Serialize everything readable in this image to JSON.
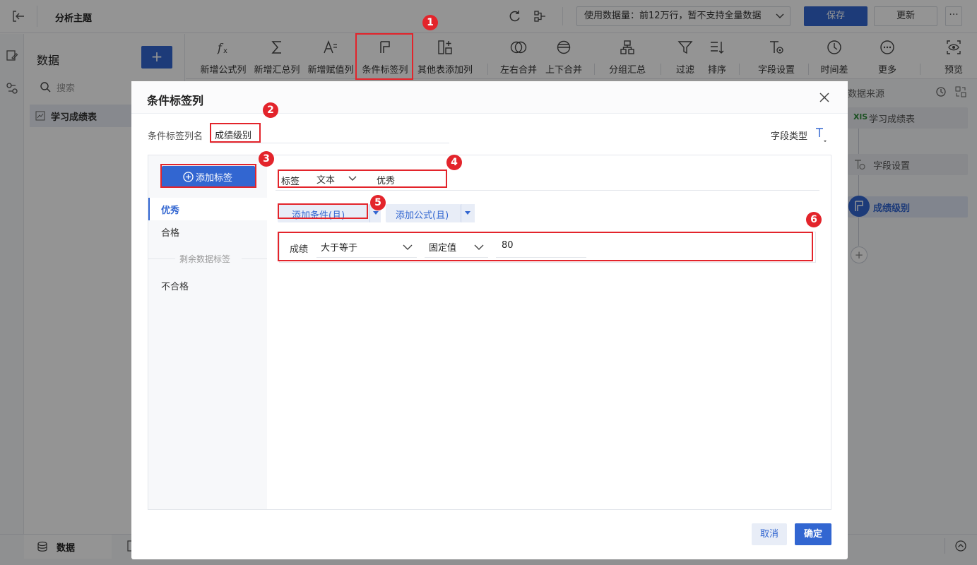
{
  "topbar": {
    "title": "分析主题",
    "data_limit": "使用数据量：前12万行，暂不支持全量数据",
    "save_label": "保存",
    "update_label": "更新",
    "more_label": "···"
  },
  "data_panel": {
    "title": "数据",
    "add_label": "+",
    "search_placeholder": "搜索",
    "table_name": "学习成绩表"
  },
  "toolbar": {
    "items": [
      {
        "label": "新增公式列",
        "icon": "fx-icon"
      },
      {
        "label": "新增汇总列",
        "icon": "sigma-icon"
      },
      {
        "label": "新增赋值列",
        "icon": "assign-icon"
      },
      {
        "label": "条件标签列",
        "icon": "flag-icon"
      },
      {
        "label": "其他表添加列",
        "icon": "add-column-icon"
      },
      {
        "label": "左右合并",
        "icon": "join-icon"
      },
      {
        "label": "上下合并",
        "icon": "union-icon"
      },
      {
        "label": "分组汇总",
        "icon": "group-icon"
      },
      {
        "label": "过滤",
        "icon": "filter-icon"
      },
      {
        "label": "排序",
        "icon": "sort-icon"
      },
      {
        "label": "字段设置",
        "icon": "field-settings-icon"
      },
      {
        "label": "时间差",
        "icon": "clock-icon"
      },
      {
        "label": "更多",
        "icon": "more-icon"
      },
      {
        "label": "预览",
        "icon": "preview-icon"
      }
    ]
  },
  "flow_panel": {
    "header": "数据来源",
    "nodes": [
      {
        "label": "学习成绩表",
        "tag": "XlS"
      },
      {
        "label": "字段设置"
      },
      {
        "label": "成绩级别"
      }
    ],
    "add_label": "+"
  },
  "bottom": {
    "tab_data": "数据"
  },
  "dialog": {
    "title": "条件标签列",
    "colname_label": "条件标签列名",
    "colname_value": "成绩级别",
    "field_type_label": "字段类型",
    "add_tag_label": "添加标签",
    "tags": [
      "优秀",
      "合格"
    ],
    "remaining_label": "剩余数据标签",
    "remaining_tag": "不合格",
    "tag_row": {
      "label": "标签",
      "type": "文本",
      "value": "优秀"
    },
    "add_condition_label": "添加条件(且)",
    "add_formula_label": "添加公式(且)",
    "condition": {
      "field": "成绩",
      "operator": "大于等于",
      "value_type": "固定值",
      "value": "80"
    },
    "cancel_label": "取消",
    "ok_label": "确定"
  },
  "callouts": [
    "1",
    "2",
    "3",
    "4",
    "5",
    "6"
  ],
  "colors": {
    "accent": "#3266d1",
    "callout": "#e3242b"
  }
}
